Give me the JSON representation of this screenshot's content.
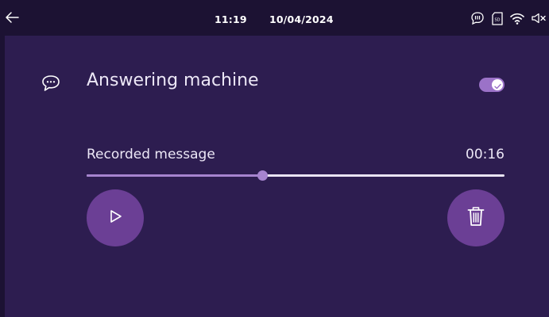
{
  "statusbar": {
    "time": "11:19",
    "date": "10/04/2024",
    "icons": [
      "voicemail-icon",
      "sd-card-icon",
      "wifi-icon",
      "speaker-muted-icon"
    ]
  },
  "header": {
    "icon": "chat-bubble-icon",
    "title": "Answering machine",
    "toggle_on": true
  },
  "recording": {
    "label": "Recorded message",
    "duration": "00:16",
    "progress": 0.42
  },
  "buttons": {
    "play": "play-icon",
    "delete": "trash-icon"
  },
  "colors": {
    "background": "#2d1d50",
    "statusbar": "#1c1233",
    "accent": "#a684cf",
    "button": "#6b3f95"
  }
}
